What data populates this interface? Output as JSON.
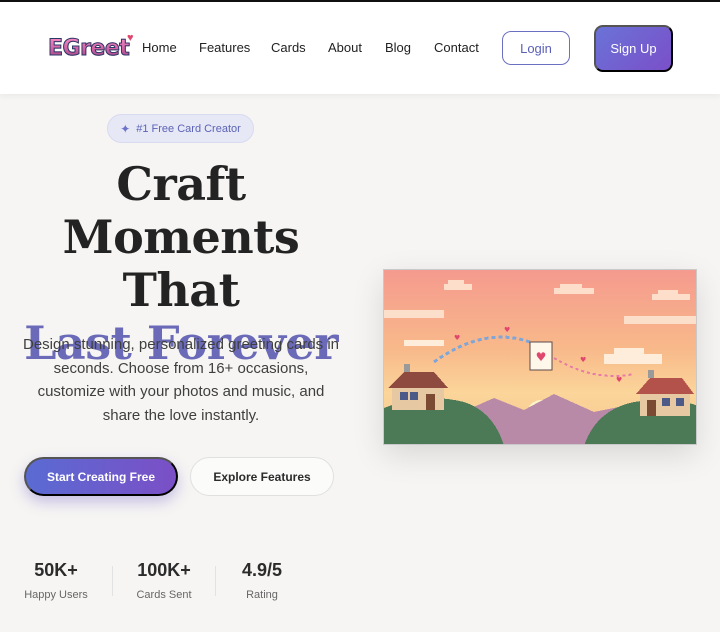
{
  "brand": {
    "logo_text": "EGreet"
  },
  "nav": {
    "links": [
      "Home",
      "Features",
      "Cards",
      "About",
      "Blog",
      "Contact"
    ],
    "login_label": "Login",
    "signup_label": "Sign Up"
  },
  "hero": {
    "badge": "#1 Free Card Creator",
    "badge_icon": "sparkle-icon",
    "title_line1": "Craft Moments",
    "title_line2": "That",
    "title_accent": "Last Forever",
    "description": "Design stunning, personalized greeting cards in seconds. Choose from 16+ occasions, customize with your photos and music, and share the love instantly.",
    "primary_cta": "Start Creating Free",
    "secondary_cta": "Explore Features"
  },
  "stats": [
    {
      "value": "50K+",
      "label": "Happy Users"
    },
    {
      "value": "100K+",
      "label": "Cards Sent"
    },
    {
      "value": "4.9/5",
      "label": "Rating"
    }
  ],
  "colors": {
    "accent": "#6a6ab8",
    "primary_gradient_start": "#5a6bd3",
    "primary_gradient_end": "#7b4fc6",
    "page_background": "#f6f5f3"
  }
}
